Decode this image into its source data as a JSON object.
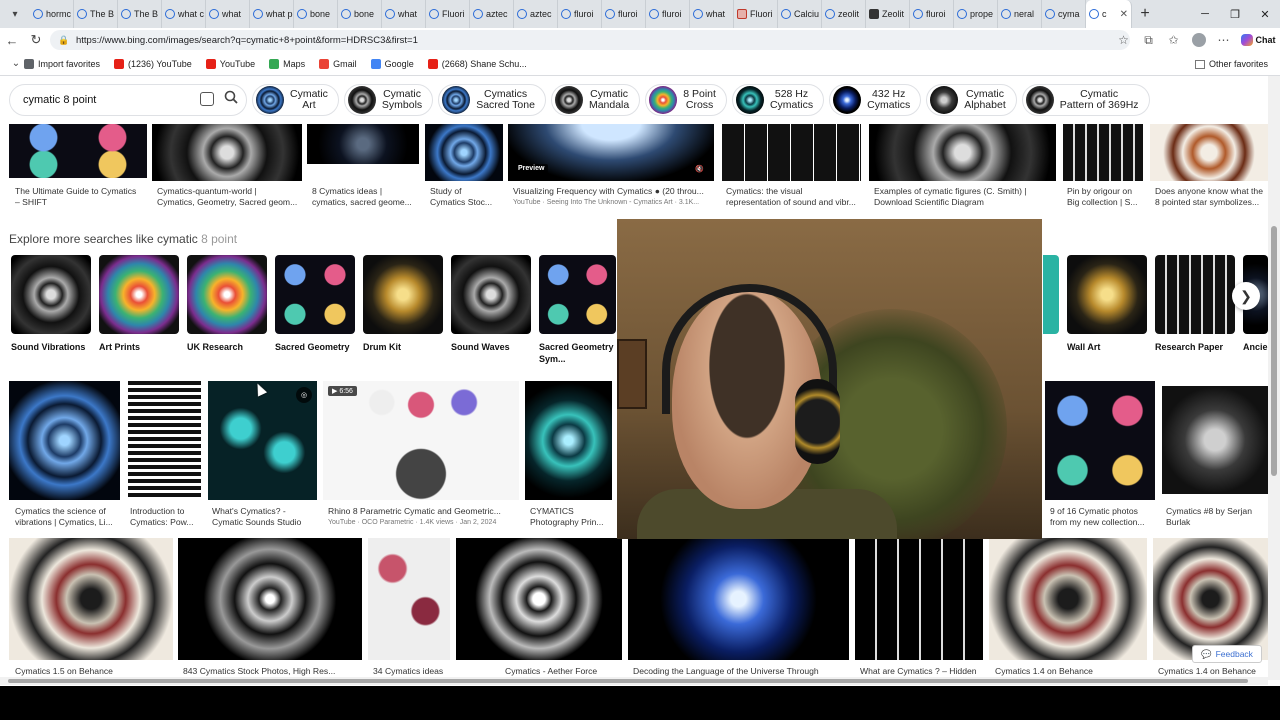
{
  "browser": {
    "tabs": [
      {
        "label": "hormc",
        "icon": "search-icon"
      },
      {
        "label": "The B",
        "icon": "search-icon"
      },
      {
        "label": "The B",
        "icon": "search-icon"
      },
      {
        "label": "what c",
        "icon": "search-icon"
      },
      {
        "label": "what",
        "icon": "search-icon"
      },
      {
        "label": "what p",
        "icon": "search-icon"
      },
      {
        "label": "bone",
        "icon": "search-icon"
      },
      {
        "label": "bone",
        "icon": "search-icon"
      },
      {
        "label": "what",
        "icon": "search-icon"
      },
      {
        "label": "Fluori",
        "icon": "search-icon"
      },
      {
        "label": "aztec",
        "icon": "search-icon"
      },
      {
        "label": "aztec",
        "icon": "search-icon"
      },
      {
        "label": "fluroi",
        "icon": "search-icon"
      },
      {
        "label": "fluroi",
        "icon": "search-icon"
      },
      {
        "label": "fluroi",
        "icon": "search-icon"
      },
      {
        "label": "what",
        "icon": "search-icon"
      },
      {
        "label": "Fluori",
        "icon": "site-icon"
      },
      {
        "label": "Calciu",
        "icon": "search-icon"
      },
      {
        "label": "zeolit",
        "icon": "search-icon"
      },
      {
        "label": "Zeolit",
        "icon": "w-icon"
      },
      {
        "label": "fluroi",
        "icon": "search-icon"
      },
      {
        "label": "prope",
        "icon": "search-icon"
      },
      {
        "label": "neral",
        "icon": "search-icon"
      },
      {
        "label": "cyma",
        "icon": "search-icon"
      },
      {
        "label": "c",
        "icon": "search-icon",
        "active": true
      }
    ],
    "url": "https://www.bing.com/images/search?q=cymatic+8+point&form=HDRSC3&first=1",
    "bookmarks": [
      {
        "label": "Import favorites",
        "color": "#5f6368"
      },
      {
        "label": "(1236) YouTube",
        "color": "#e62117"
      },
      {
        "label": "YouTube",
        "color": "#e62117"
      },
      {
        "label": "Maps",
        "color": "#34a853"
      },
      {
        "label": "Gmail",
        "color": "#ea4335"
      },
      {
        "label": "Google",
        "color": "#4285f4"
      },
      {
        "label": "(2668) Shane Schu...",
        "color": "#e62117"
      }
    ],
    "other_favorites": "Other favorites",
    "chat_label": "Chat"
  },
  "search": {
    "query": "cymatic 8 point"
  },
  "chips": [
    {
      "l1": "Cymatic",
      "l2": "Art",
      "thumb": "g-cymatic"
    },
    {
      "l1": "Cymatic",
      "l2": "Symbols",
      "thumb": "g-bw"
    },
    {
      "l1": "Cymatics",
      "l2": "Sacred Tone",
      "thumb": "g-cymatic"
    },
    {
      "l1": "Cymatic",
      "l2": "Mandala",
      "thumb": "g-bw"
    },
    {
      "l1": "8 Point",
      "l2": "Cross",
      "thumb": "g-rainbow"
    },
    {
      "l1": "528 Hz",
      "l2": "Cymatics",
      "thumb": "g-teal"
    },
    {
      "l1": "432 Hz",
      "l2": "Cymatics",
      "thumb": "g-blueorb"
    },
    {
      "l1": "Cymatic",
      "l2": "Alphabet",
      "thumb": "g-gray"
    },
    {
      "l1": "Cymatic",
      "l2": "Pattern of 369Hz",
      "thumb": "g-bw"
    }
  ],
  "row1_captions": [
    {
      "l1": "The Ultimate Guide to Cymatics",
      "l2": "– SHIFT"
    },
    {
      "l1": "Cymatics-quantum-world |",
      "l2": "Cymatics, Geometry, Sacred geom..."
    },
    {
      "l1": "8 Cymatics ideas |",
      "l2": "cymatics, sacred geome..."
    },
    {
      "l1": "Study of",
      "l2": "Cymatics Stoc..."
    },
    {
      "l1": "Visualizing Frequency with Cymatics ● (20 throu...",
      "l2": "YouTube · Seeing Into The Unknown - Cymatics Art · 3.1K..."
    },
    {
      "l1": "Cymatics: the visual",
      "l2": "representation of sound and vibr..."
    },
    {
      "l1": "Examples of cymatic figures (C. Smith) |",
      "l2": "Download Scientific Diagram"
    },
    {
      "l1": "Pin by origour on",
      "l2": "Big collection | S..."
    },
    {
      "l1": "Does anyone know what the",
      "l2": "8 pointed star symbolizes..."
    }
  ],
  "preview_badge": "Preview",
  "explore": {
    "title_main": "Explore more searches like cymatic ",
    "title_em": "8 point",
    "items": [
      {
        "label": "Sound Vibrations",
        "thumb": "g-bw"
      },
      {
        "label": "Art Prints",
        "thumb": "g-rainbow"
      },
      {
        "label": "UK Research",
        "thumb": "g-rainbow"
      },
      {
        "label": "Sacred Geometry",
        "thumb": "g-multi"
      },
      {
        "label": "Drum Kit",
        "thumb": "g-gold"
      },
      {
        "label": "Sound Waves",
        "thumb": "g-bw"
      },
      {
        "label": "Sacred Geometry Sym...",
        "thumb": "g-multi"
      },
      {
        "label": "Wall Art",
        "thumb": "g-gold"
      },
      {
        "label": "Research Paper",
        "thumb": "g-grid"
      },
      {
        "label": "Ancien",
        "thumb": "g-dark"
      }
    ]
  },
  "row3_captions": [
    {
      "l1": "Cymatics the science of",
      "l2": "vibrations | Cymatics, Li..."
    },
    {
      "l1": "Introduction to",
      "l2": "Cymatics: Pow..."
    },
    {
      "l1": "What's Cymatics? -",
      "l2": "Cymatic Sounds Studio"
    },
    {
      "l1": "Rhino 8 Parametric Cymatic and Geometric...",
      "l2": "YouTube · OCO Parametric · 1.4K views · Jan 2, 2024"
    },
    {
      "l1": "CYMATICS",
      "l2": "Photography Prin..."
    },
    {
      "l1": "9 of 16 Cymatic photos",
      "l2": "from my new collection..."
    },
    {
      "l1": "Cymatics #8 by Serjan",
      "l2": "Burlak"
    }
  ],
  "video_badge": "▶ 6:56",
  "row4_captions": [
    "Cymatics 1.5 on Behance",
    "843 Cymatics Stock Photos, High Res...",
    "34 Cymatics ideas",
    "Cymatics - Aether Force",
    "Decoding the Language of the Universe Through",
    "What are Cymatics ? – Hidden",
    "Cymatics 1.4 on Behance",
    "Cymatics 1.4 on Behance"
  ],
  "feedback_label": "Feedback",
  "colors": {
    "accent": "#3b6fd1",
    "chrome_tabstrip": "#dfe3e7"
  }
}
